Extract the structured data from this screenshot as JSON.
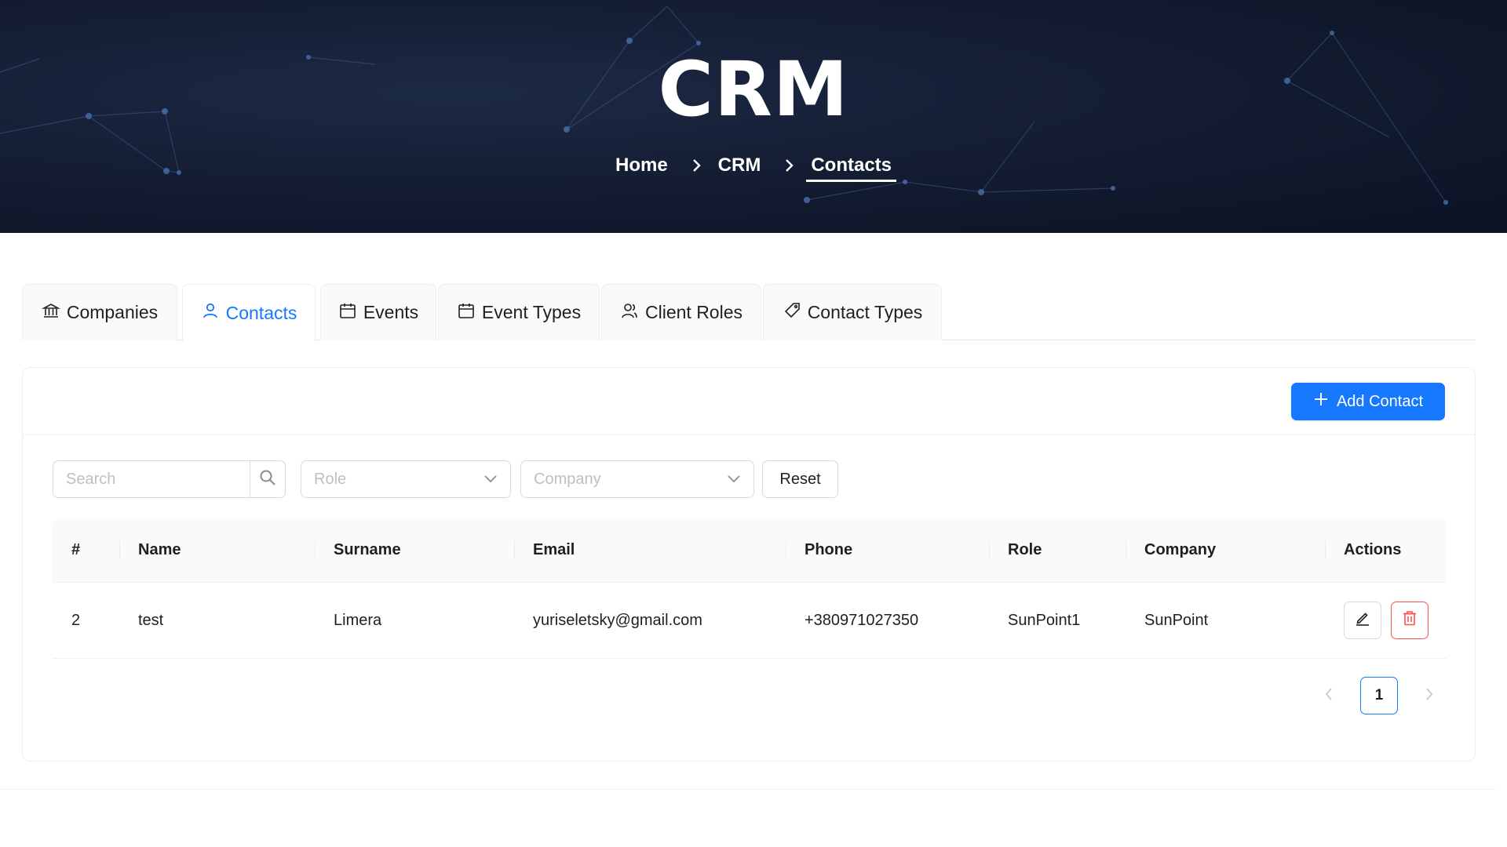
{
  "hero": {
    "title": "CRM",
    "breadcrumb": [
      "Home",
      "CRM",
      "Contacts"
    ]
  },
  "tabs": [
    {
      "label": "Companies",
      "icon": "bank-icon",
      "active": false
    },
    {
      "label": "Contacts",
      "icon": "user-icon",
      "active": true
    },
    {
      "label": "Events",
      "icon": "calendar-icon",
      "active": false
    },
    {
      "label": "Event Types",
      "icon": "calendar-icon",
      "active": false
    },
    {
      "label": "Client Roles",
      "icon": "users-icon",
      "active": false
    },
    {
      "label": "Contact Types",
      "icon": "tag-icon",
      "active": false
    }
  ],
  "toolbar": {
    "add_label": "Add Contact"
  },
  "filters": {
    "search_placeholder": "Search",
    "role_placeholder": "Role",
    "company_placeholder": "Company",
    "reset_label": "Reset"
  },
  "table": {
    "columns": [
      "#",
      "Name",
      "Surname",
      "Email",
      "Phone",
      "Role",
      "Company",
      "Actions"
    ],
    "rows": [
      {
        "id": "2",
        "name": "test",
        "surname": "Limera",
        "email": "yuriseletsky@gmail.com",
        "phone": "+380971027350",
        "role": "SunPoint1",
        "company": "SunPoint"
      }
    ]
  },
  "pagination": {
    "current": "1"
  },
  "colors": {
    "primary": "#1677ff",
    "danger": "#ff4d4f",
    "hero_bg": "#141d33"
  }
}
